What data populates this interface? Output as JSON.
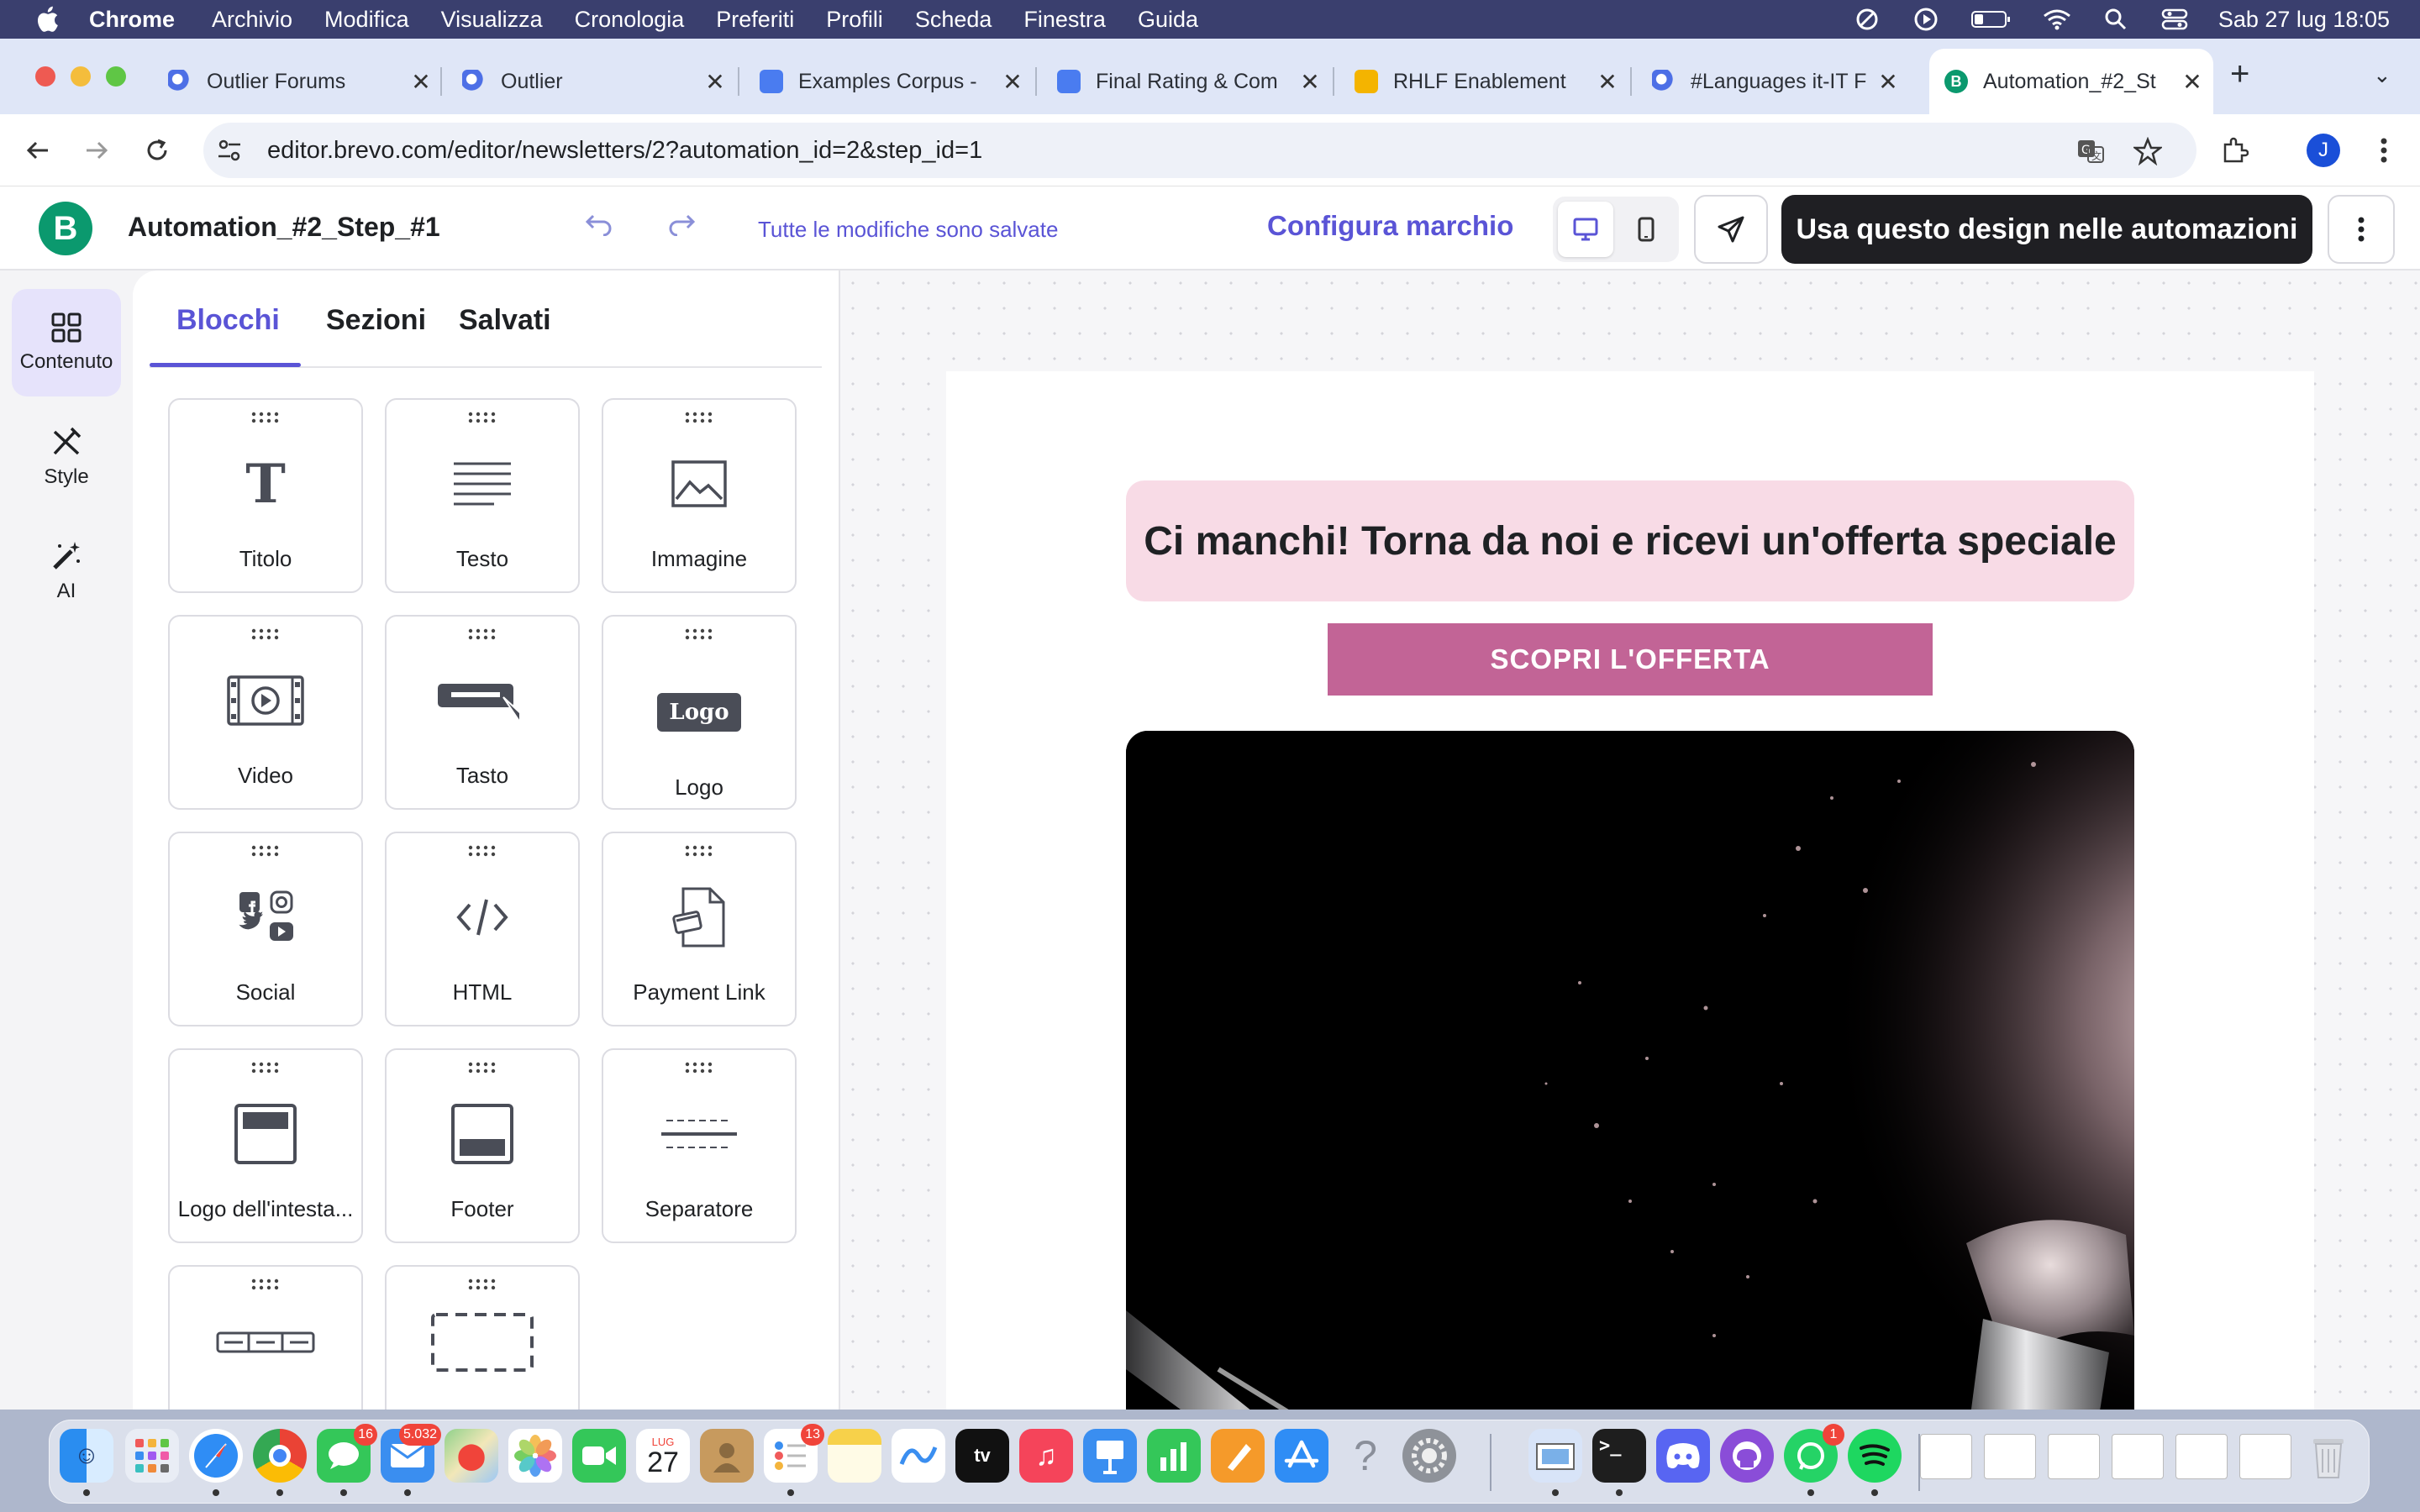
{
  "menubar": {
    "app": "Chrome",
    "items": [
      "Archivio",
      "Modifica",
      "Visualizza",
      "Cronologia",
      "Preferiti",
      "Profili",
      "Scheda",
      "Finestra",
      "Guida"
    ],
    "datetime": "Sab 27 lug  18:05"
  },
  "tabs": [
    {
      "title": "Outlier Forums",
      "favicon": "outlier-icon"
    },
    {
      "title": "Outlier",
      "favicon": "outlier-icon"
    },
    {
      "title": "Examples Corpus -",
      "favicon": "google-docs-icon"
    },
    {
      "title": "Final Rating & Com",
      "favicon": "google-docs-icon"
    },
    {
      "title": "RHLF Enablement",
      "favicon": "google-slides-icon"
    },
    {
      "title": "#Languages it-IT F",
      "favicon": "outlier-icon"
    },
    {
      "title": "Automation_#2_St",
      "favicon": "brevo-icon",
      "active": true
    }
  ],
  "address": {
    "url": "editor.brevo.com/editor/newsletters/2?automation_id=2&step_id=1"
  },
  "profile": {
    "initial": "J"
  },
  "editor": {
    "logo_letter": "B",
    "title": "Automation_#2_Step_#1",
    "saved_status": "Tutte le modifiche sono salvate",
    "brand_link": "Configura marchio",
    "primary_action": "Usa questo design nelle automazioni",
    "accent_color": "#5a54d6"
  },
  "rail": [
    {
      "label": "Contenuto",
      "icon": "grid-icon",
      "active": true
    },
    {
      "label": "Style",
      "icon": "brush-icon"
    },
    {
      "label": "AI",
      "icon": "magic-wand-icon"
    }
  ],
  "panel": {
    "tabs": [
      "Blocchi",
      "Sezioni",
      "Salvati"
    ],
    "blocks": [
      {
        "label": "Titolo",
        "icon": "title-icon"
      },
      {
        "label": "Testo",
        "icon": "text-icon"
      },
      {
        "label": "Immagine",
        "icon": "image-icon"
      },
      {
        "label": "Video",
        "icon": "video-icon"
      },
      {
        "label": "Tasto",
        "icon": "button-icon"
      },
      {
        "label": "Logo",
        "icon": "logo-icon",
        "badge": "Logo"
      },
      {
        "label": "Social",
        "icon": "social-icon"
      },
      {
        "label": "HTML",
        "icon": "code-icon"
      },
      {
        "label": "Payment Link",
        "icon": "payment-link-icon"
      },
      {
        "label": "Logo dell'intesta...",
        "icon": "header-logo-icon"
      },
      {
        "label": "Footer",
        "icon": "footer-icon"
      },
      {
        "label": "Separatore",
        "icon": "divider-icon"
      },
      {
        "label": "",
        "icon": "navigation-icon"
      },
      {
        "label": "",
        "icon": "spacer-icon"
      }
    ]
  },
  "email": {
    "headline": "Ci manchi! Torna da noi e ricevi un'offerta speciale",
    "cta": "SCOPRI L'OFFERTA",
    "headline_bg": "#f8dbe6",
    "cta_color": "#c26496"
  },
  "dock": {
    "badges": {
      "messages": "16",
      "mail": "5.032",
      "reminders": "13",
      "whatsapp": "1"
    },
    "calendar": {
      "month": "LUG",
      "day": "27"
    }
  }
}
